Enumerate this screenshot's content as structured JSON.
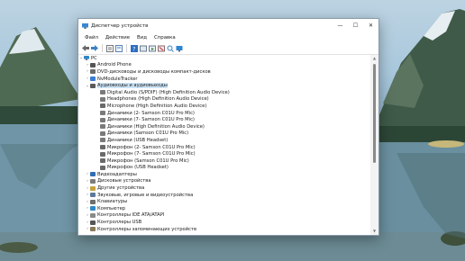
{
  "window": {
    "title": "Диспетчер устройств",
    "controls": {
      "minimize": "—",
      "maximize": "☐",
      "close": "✕"
    }
  },
  "menu": [
    "Файл",
    "Действие",
    "Вид",
    "Справка"
  ],
  "toolbar": [
    "back-arrow-icon",
    "forward-arrow-icon",
    "separator",
    "properties-icon",
    "list-icon",
    "separator",
    "help-icon",
    "driver-icon",
    "update-icon",
    "uninstall-icon",
    "scan-icon",
    "monitor-icon"
  ],
  "tree": {
    "root": "PC",
    "rows": [
      {
        "depth": 1,
        "expander": "›",
        "icon": "phone",
        "label": "Android Phone"
      },
      {
        "depth": 1,
        "expander": "›",
        "icon": "dvd",
        "label": "DVD-дисководы и дисководы компакт-дисков"
      },
      {
        "depth": 1,
        "expander": "›",
        "icon": "tracker",
        "label": "NvModuleTracker"
      },
      {
        "depth": 1,
        "expander": "⌄",
        "icon": "audio",
        "label": "Аудиовходы и аудиовыходы",
        "selected": true
      },
      {
        "depth": 2,
        "expander": "",
        "icon": "speaker",
        "label": "Digital Audio (S/PDIF) (High Definition Audio Device)"
      },
      {
        "depth": 2,
        "expander": "",
        "icon": "speaker",
        "label": "Headphones (High Definition Audio Device)"
      },
      {
        "depth": 2,
        "expander": "",
        "icon": "mic",
        "label": "Microphone (High Definition Audio Device)"
      },
      {
        "depth": 2,
        "expander": "",
        "icon": "speaker",
        "label": "Динамики (2- Samson C01U Pro Mic)"
      },
      {
        "depth": 2,
        "expander": "",
        "icon": "speaker",
        "label": "Динамики (7- Samson C01U Pro Mic)"
      },
      {
        "depth": 2,
        "expander": "",
        "icon": "speaker",
        "label": "Динамики (High Definition Audio Device)"
      },
      {
        "depth": 2,
        "expander": "",
        "icon": "speaker",
        "label": "Динамики (Samson C01U Pro Mic)"
      },
      {
        "depth": 2,
        "expander": "",
        "icon": "speaker",
        "label": "Динамики (USB Headset)"
      },
      {
        "depth": 2,
        "expander": "",
        "icon": "mic",
        "label": "Микрофон (2- Samson C01U Pro Mic)"
      },
      {
        "depth": 2,
        "expander": "",
        "icon": "mic",
        "label": "Микрофон (7- Samson C01U Pro Mic)"
      },
      {
        "depth": 2,
        "expander": "",
        "icon": "mic",
        "label": "Микрофон (Samson C01U Pro Mic)"
      },
      {
        "depth": 2,
        "expander": "",
        "icon": "mic",
        "label": "Микрофон (USB Headset)"
      },
      {
        "depth": 1,
        "expander": "›",
        "icon": "display",
        "label": "Видеоадаптеры"
      },
      {
        "depth": 1,
        "expander": "›",
        "icon": "disk",
        "label": "Дисковые устройства"
      },
      {
        "depth": 1,
        "expander": "›",
        "icon": "other",
        "label": "Другие устройства"
      },
      {
        "depth": 1,
        "expander": "›",
        "icon": "sound",
        "label": "Звуковые, игровые и видеоустройства"
      },
      {
        "depth": 1,
        "expander": "›",
        "icon": "keyboard",
        "label": "Клавиатуры"
      },
      {
        "depth": 1,
        "expander": "›",
        "icon": "computer",
        "label": "Компьютер"
      },
      {
        "depth": 1,
        "expander": "›",
        "icon": "ide",
        "label": "Контроллеры IDE ATA/ATAPI"
      },
      {
        "depth": 1,
        "expander": "›",
        "icon": "usb",
        "label": "Контроллеры USB"
      },
      {
        "depth": 1,
        "expander": "›",
        "icon": "storage",
        "label": "Контроллеры запоминающих устройств"
      }
    ]
  },
  "icon_colors": {
    "phone": "#555555",
    "dvd": "#6b6b6b",
    "tracker": "#3a7bd5",
    "audio": "#5a5a5a",
    "speaker": "#7a7a7a",
    "mic": "#6a6a6a",
    "display": "#2f6db5",
    "disk": "#7d7d7d",
    "other": "#c8a23c",
    "sound": "#5c7a9a",
    "keyboard": "#6e6e6e",
    "computer": "#2f86c8",
    "ide": "#8a8a8a",
    "usb": "#555555",
    "storage": "#8a7a5a"
  },
  "accent": "#0078d4"
}
